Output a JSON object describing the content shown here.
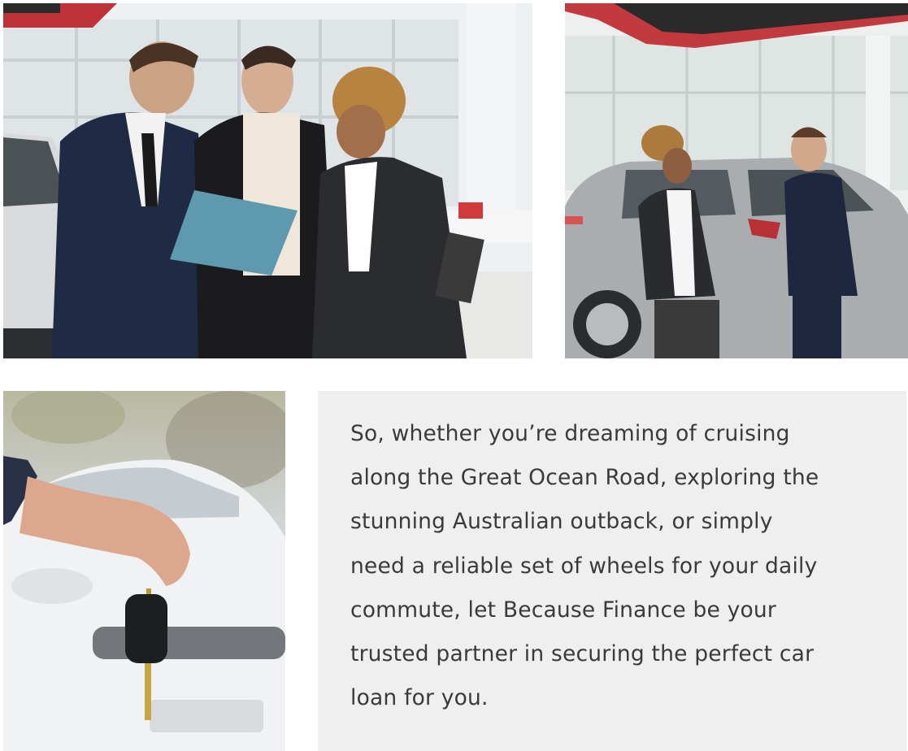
{
  "images": {
    "top_left": {
      "alt": "Salesman showing clipboard to couple in car showroom"
    },
    "top_right": {
      "alt": "Salesman with folder talking to woman beside silver SUV"
    },
    "bottom_left": {
      "alt": "Hand holding car key in front of white car"
    }
  },
  "text_panel": {
    "lines": [
      "So, whether you’re dreaming of cruising",
      "along the Great Ocean Road, exploring the",
      "stunning Australian outback, or simply",
      "need a reliable set of wheels for your daily",
      "commute, let Because Finance be your",
      "trusted partner in securing the perfect car",
      "loan for you."
    ]
  },
  "colors": {
    "panel_background": "#efefef",
    "text": "#3a3a3a"
  }
}
